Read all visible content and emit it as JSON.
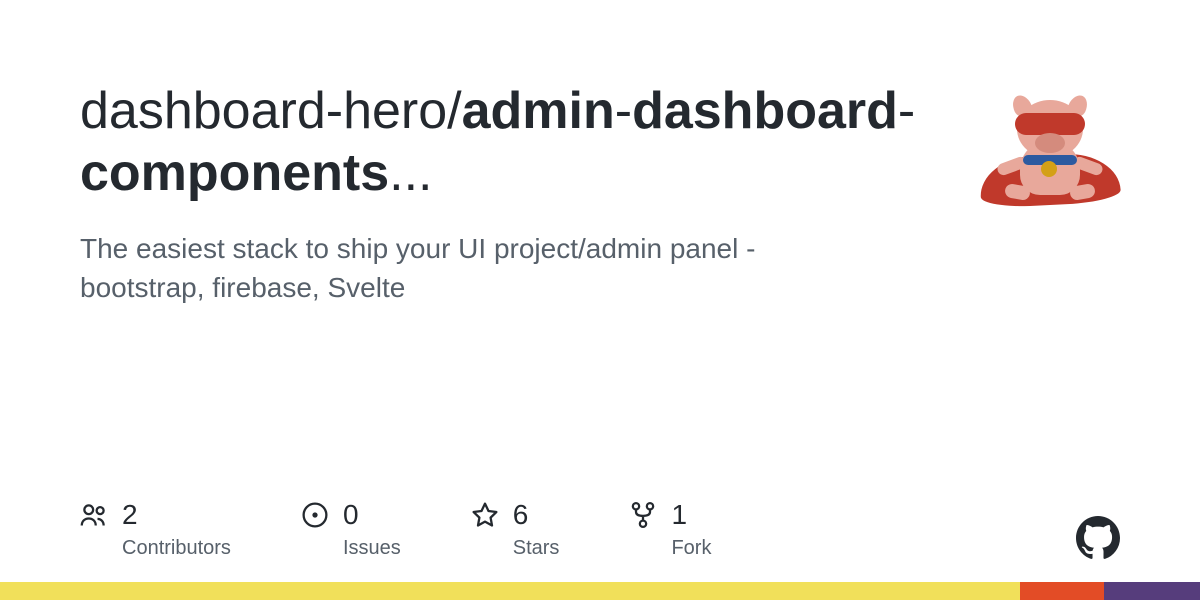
{
  "repo": {
    "owner": "dashboard-hero",
    "slash": "/",
    "name_part1": "admin",
    "name_sep1": "-",
    "name_part2": "dashboard",
    "name_sep2": "-",
    "name_part3": "components",
    "ellipsis": "...",
    "description": "The easiest stack to ship your UI project/admin panel - bootstrap, firebase, Svelte"
  },
  "stats": {
    "contributors": {
      "count": "2",
      "label": "Contributors"
    },
    "issues": {
      "count": "0",
      "label": "Issues"
    },
    "stars": {
      "count": "6",
      "label": "Stars"
    },
    "forks": {
      "count": "1",
      "label": "Fork"
    }
  }
}
